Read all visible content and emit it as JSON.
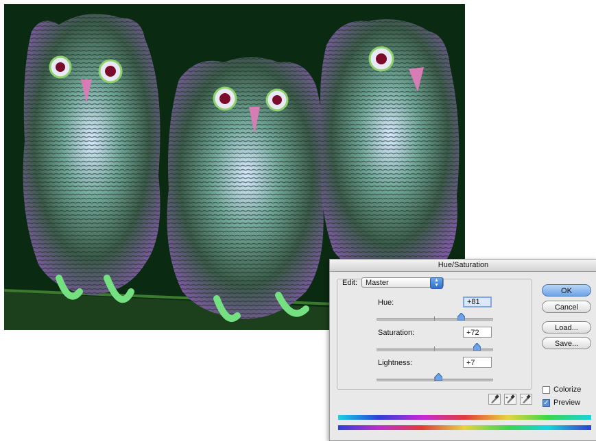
{
  "dialog": {
    "title": "Hue/Saturation",
    "edit_label": "Edit:",
    "edit_value": "Master",
    "hue": {
      "label": "Hue:",
      "value": "+81",
      "level": 81
    },
    "saturation": {
      "label": "Saturation:",
      "value": "+72",
      "level": 72
    },
    "lightness": {
      "label": "Lightness:",
      "value": "+7",
      "level": 7
    },
    "buttons": {
      "ok": "OK",
      "cancel": "Cancel",
      "load": "Load...",
      "save": "Save..."
    },
    "colorize": {
      "label": "Colorize",
      "checked": false
    },
    "preview": {
      "label": "Preview",
      "checked": true
    }
  },
  "colors": {
    "photo_background": "#0b2a12",
    "dialog_background": "#e9e9e9",
    "accent": "#6ea3e6"
  }
}
